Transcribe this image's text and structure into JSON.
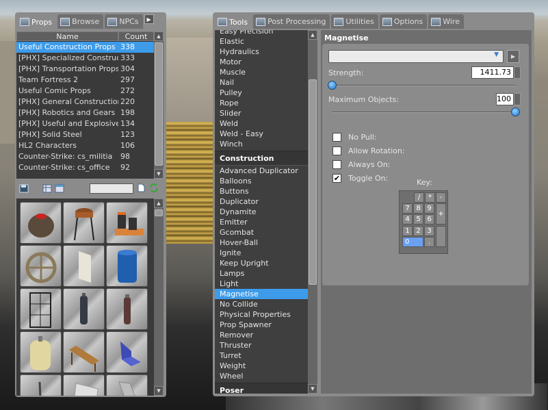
{
  "props_panel": {
    "tabs": [
      {
        "label": "Props",
        "active": true
      },
      {
        "label": "Browse",
        "active": false
      },
      {
        "label": "NPCs",
        "active": false
      }
    ],
    "columns": {
      "name": "Name",
      "count": "Count"
    },
    "rows": [
      {
        "name": "Useful Construction Props",
        "count": "338",
        "selected": true
      },
      {
        "name": "[PHX] Specialized Constructi...",
        "count": "333"
      },
      {
        "name": "[PHX] Transportation Props",
        "count": "304"
      },
      {
        "name": "Team Fortress 2",
        "count": "297"
      },
      {
        "name": "Useful Comic Props",
        "count": "272"
      },
      {
        "name": "[PHX] General Construction ...",
        "count": "220"
      },
      {
        "name": "[PHX] Robotics and Gears",
        "count": "198"
      },
      {
        "name": "[PHX] Useful and Explosive ...",
        "count": "134"
      },
      {
        "name": "[PHX] Solid Steel",
        "count": "123"
      },
      {
        "name": "HL2 Characters",
        "count": "106"
      },
      {
        "name": "Counter-Strike: cs_militia",
        "count": "98"
      },
      {
        "name": "Counter-Strike: cs_office",
        "count": "92"
      }
    ],
    "search_value": "",
    "thumbs": [
      "explosive-barrel",
      "water-tower",
      "barrels-pallet",
      "wheel",
      "panel",
      "blue-barrel",
      "fence-grate",
      "gas-canister",
      "canister",
      "tank",
      "bench",
      "chair",
      "pole",
      "sheet",
      "plank"
    ]
  },
  "tools_panel": {
    "tabs": [
      {
        "label": "Tools",
        "active": true
      },
      {
        "label": "Post Processing"
      },
      {
        "label": "Utilities"
      },
      {
        "label": "Options"
      },
      {
        "label": "Wire"
      }
    ],
    "list_top": [
      "Easy Precision",
      "Elastic",
      "Hydraulics",
      "Motor",
      "Muscle",
      "Nail",
      "Pulley",
      "Rope",
      "Slider",
      "Weld",
      "Weld - Easy",
      "Winch"
    ],
    "cat_construction": "Construction",
    "list_construction": [
      "Advanced Duplicator",
      "Balloons",
      "Buttons",
      "Duplicator",
      "Dynamite",
      "Emitter",
      "Gcombat",
      "Hover-Ball",
      "Ignite",
      "Keep Upright",
      "Lamps",
      "Light",
      "Magnetise",
      "No Collide",
      "Physical Properties",
      "Prop Spawner",
      "Remover",
      "Thruster",
      "Turret",
      "Weight",
      "Wheel"
    ],
    "selected_tool": "Magnetise",
    "cat_poser": "Poser",
    "cpanel": {
      "title": "Magnetise",
      "strength_label": "Strength:",
      "strength_value": "1411.73",
      "strength_fraction": 0.0,
      "maxobj_label": "Maximum Objects:",
      "maxobj_value": "100",
      "maxobj_fraction": 1.0,
      "checks": [
        {
          "label": "No Pull:",
          "checked": false
        },
        {
          "label": "Allow Rotation:",
          "checked": false
        },
        {
          "label": "Always On:",
          "checked": false
        },
        {
          "label": "Toggle On:",
          "checked": true
        }
      ],
      "key_label": "Key:",
      "keys": {
        "div": "/",
        "mul": "*",
        "sub": "-",
        "k7": "7",
        "k8": "8",
        "k9": "9",
        "add": "+",
        "k4": "4",
        "k5": "5",
        "k6": "6",
        "k1": "1",
        "k2": "2",
        "k3": "3",
        "k0": "0",
        "dot": "."
      },
      "check_mark": "✔"
    }
  },
  "colors": {
    "selection": "#3d9bea",
    "panel": "#8b8b8b"
  }
}
